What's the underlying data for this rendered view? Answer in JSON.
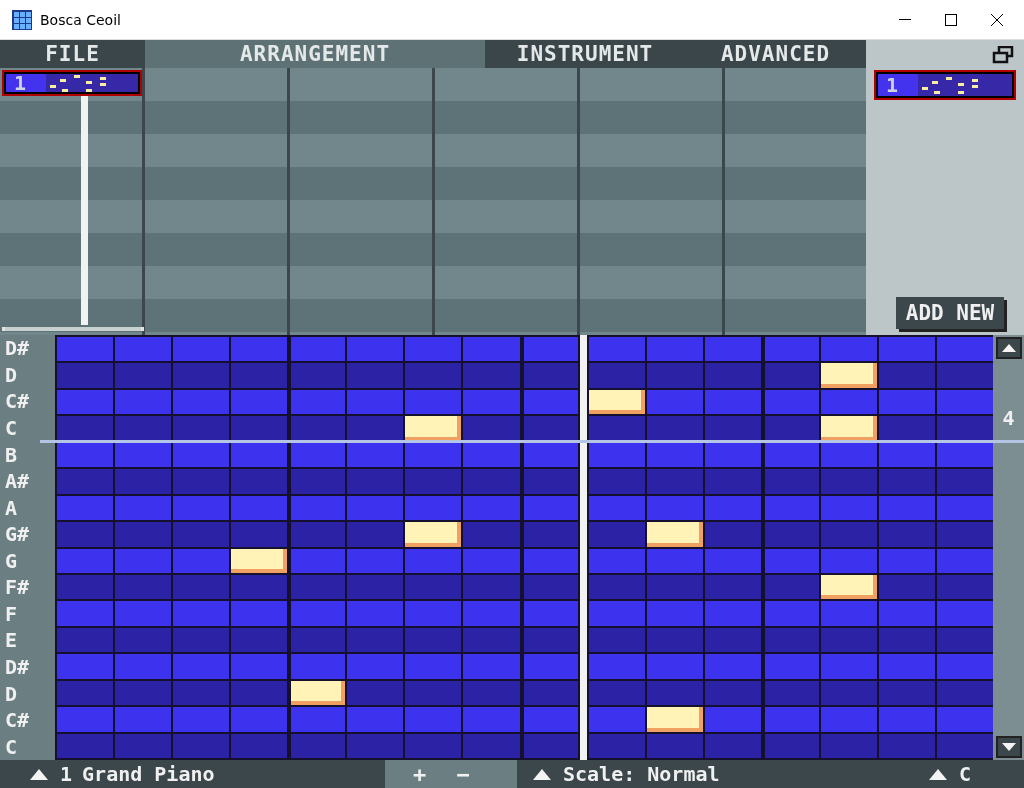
{
  "window": {
    "title": "Bosca Ceoil"
  },
  "tabs": [
    {
      "label": "FILE",
      "selected": false
    },
    {
      "label": "ARRANGEMENT",
      "selected": true
    },
    {
      "label": "INSTRUMENT",
      "selected": false
    },
    {
      "label": "ADVANCED",
      "selected": false
    }
  ],
  "arrangement": {
    "columns": [
      {
        "pattern": "1"
      },
      {},
      {},
      {},
      {},
      {}
    ]
  },
  "pattern_panel": {
    "pattern": "1",
    "add_button": "ADD NEW"
  },
  "piano_roll": {
    "octave": "4",
    "keys": [
      {
        "label": "D#",
        "steps": [
          false,
          false,
          false,
          false,
          false,
          false,
          false,
          false,
          false,
          false,
          false,
          false,
          false,
          false,
          false,
          false
        ]
      },
      {
        "label": "D",
        "steps": [
          false,
          false,
          false,
          false,
          false,
          false,
          false,
          false,
          false,
          false,
          false,
          false,
          false,
          true,
          false,
          false
        ]
      },
      {
        "label": "C#",
        "steps": [
          false,
          false,
          false,
          false,
          false,
          false,
          false,
          false,
          false,
          true,
          false,
          false,
          false,
          false,
          false,
          false
        ]
      },
      {
        "label": "C",
        "steps": [
          false,
          false,
          false,
          false,
          false,
          false,
          true,
          false,
          false,
          false,
          false,
          false,
          false,
          true,
          false,
          false
        ]
      },
      {
        "label": "B",
        "steps": [
          false,
          false,
          false,
          false,
          false,
          false,
          false,
          false,
          false,
          false,
          false,
          false,
          false,
          false,
          false,
          false
        ]
      },
      {
        "label": "A#",
        "steps": [
          false,
          false,
          false,
          false,
          false,
          false,
          false,
          false,
          false,
          false,
          false,
          false,
          false,
          false,
          false,
          false
        ]
      },
      {
        "label": "A",
        "steps": [
          false,
          false,
          false,
          false,
          false,
          false,
          false,
          false,
          false,
          false,
          false,
          false,
          false,
          false,
          false,
          false
        ]
      },
      {
        "label": "G#",
        "steps": [
          false,
          false,
          false,
          false,
          false,
          false,
          true,
          false,
          false,
          false,
          true,
          false,
          false,
          false,
          false,
          false
        ]
      },
      {
        "label": "G",
        "steps": [
          false,
          false,
          false,
          true,
          false,
          false,
          false,
          false,
          false,
          false,
          false,
          false,
          false,
          false,
          false,
          false
        ]
      },
      {
        "label": "F#",
        "steps": [
          false,
          false,
          false,
          false,
          false,
          false,
          false,
          false,
          false,
          false,
          false,
          false,
          false,
          true,
          false,
          false
        ]
      },
      {
        "label": "F",
        "steps": [
          false,
          false,
          false,
          false,
          false,
          false,
          false,
          false,
          false,
          false,
          false,
          false,
          false,
          false,
          false,
          false
        ]
      },
      {
        "label": "E",
        "steps": [
          false,
          false,
          false,
          false,
          false,
          false,
          false,
          false,
          false,
          false,
          false,
          false,
          false,
          false,
          false,
          false
        ]
      },
      {
        "label": "D#",
        "steps": [
          false,
          false,
          false,
          false,
          false,
          false,
          false,
          false,
          false,
          false,
          false,
          false,
          false,
          false,
          false,
          false
        ]
      },
      {
        "label": "D",
        "steps": [
          false,
          false,
          false,
          false,
          true,
          false,
          false,
          false,
          false,
          false,
          false,
          false,
          false,
          false,
          false,
          false
        ]
      },
      {
        "label": "C#",
        "steps": [
          false,
          false,
          false,
          false,
          false,
          false,
          false,
          false,
          false,
          false,
          true,
          false,
          false,
          false,
          false,
          false
        ]
      },
      {
        "label": "C",
        "steps": [
          false,
          false,
          false,
          false,
          false,
          false,
          false,
          false,
          false,
          false,
          false,
          false,
          false,
          false,
          false,
          false
        ]
      }
    ]
  },
  "bottom_bar": {
    "instrument_number": "1",
    "instrument_name": "Grand Piano",
    "plus": "+",
    "minus": "−",
    "scale": "Scale: Normal",
    "key": "C"
  }
}
